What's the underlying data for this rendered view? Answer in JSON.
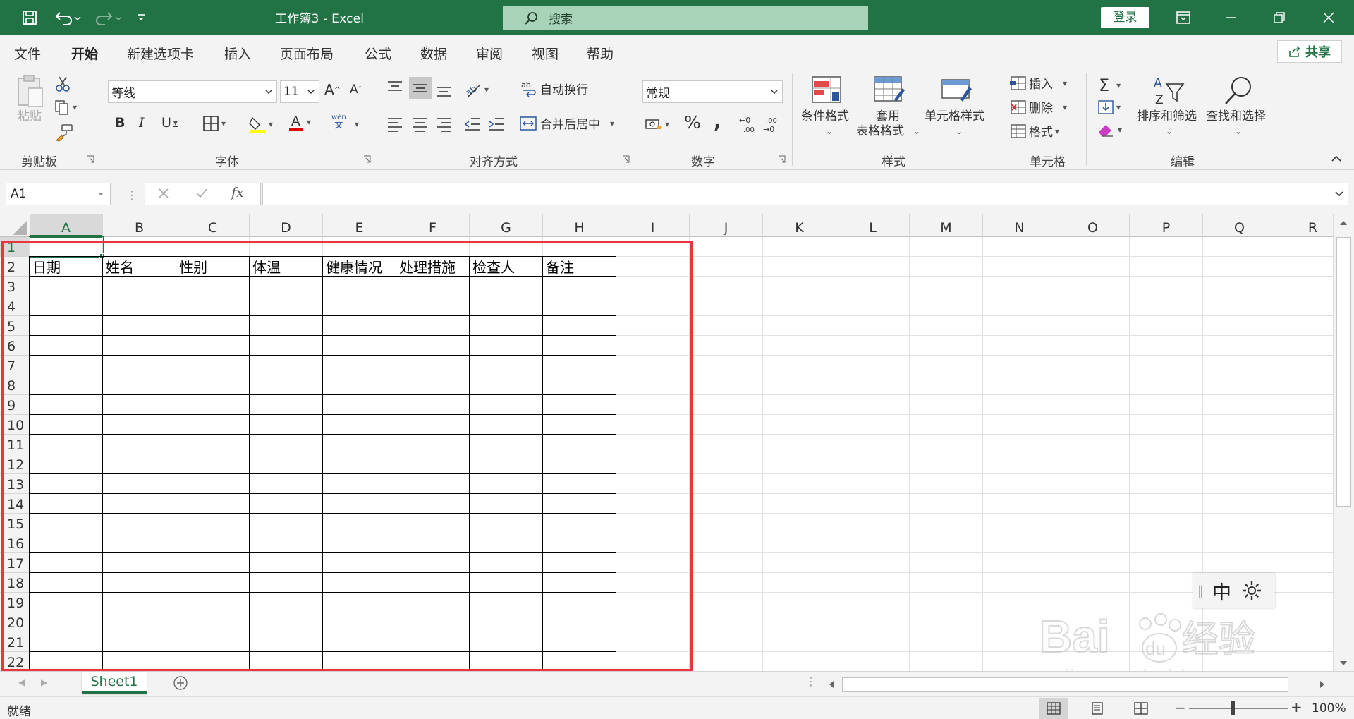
{
  "window": {
    "title": "工作簿3 - Excel",
    "search_placeholder": "搜索",
    "login_label": "登录",
    "accent_color": "#217346"
  },
  "menu": {
    "tabs": [
      {
        "label": "文件",
        "active": false
      },
      {
        "label": "开始",
        "active": true
      },
      {
        "label": "新建选项卡",
        "active": false
      },
      {
        "label": "插入",
        "active": false
      },
      {
        "label": "页面布局",
        "active": false
      },
      {
        "label": "公式",
        "active": false
      },
      {
        "label": "数据",
        "active": false
      },
      {
        "label": "审阅",
        "active": false
      },
      {
        "label": "视图",
        "active": false
      },
      {
        "label": "帮助",
        "active": false
      }
    ],
    "share_label": "共享"
  },
  "ribbon": {
    "clipboard": {
      "label": "剪贴板",
      "paste": "粘贴"
    },
    "font": {
      "label": "字体",
      "font_name": "等线",
      "font_size": "11",
      "bold": "B",
      "italic": "I",
      "underline": "U",
      "phonetic": "wén",
      "phonetic_sub": "文"
    },
    "alignment": {
      "label": "对齐方式",
      "wrap_text": "自动换行",
      "merge_center": "合并后居中"
    },
    "number": {
      "label": "数字",
      "format": "常规",
      "percent": "%",
      "comma": ","
    },
    "styles": {
      "label": "样式",
      "conditional": "条件格式",
      "table_format_1": "套用",
      "table_format_2": "表格格式",
      "cell_styles": "单元格样式"
    },
    "cells": {
      "label": "单元格",
      "insert": "插入",
      "delete": "删除",
      "format": "格式"
    },
    "editing": {
      "label": "编辑",
      "sort_filter": "排序和筛选",
      "find_select": "查找和选择"
    }
  },
  "formula_bar": {
    "name_box": "A1",
    "fx": "fx",
    "value": ""
  },
  "grid": {
    "columns": [
      "A",
      "B",
      "C",
      "D",
      "E",
      "F",
      "G",
      "H",
      "I",
      "J",
      "K",
      "L",
      "M",
      "N",
      "O",
      "P",
      "Q",
      "R"
    ],
    "rows": [
      "1",
      "2",
      "3",
      "4",
      "5",
      "6",
      "7",
      "8",
      "9",
      "10",
      "11",
      "12",
      "13",
      "14",
      "15",
      "16",
      "17",
      "18",
      "19",
      "20",
      "21",
      "22"
    ],
    "selected_cell": "A1",
    "table_headers": [
      "日期",
      "姓名",
      "性别",
      "体温",
      "健康情况",
      "处理措施",
      "检查人",
      "备注"
    ],
    "highlight_color": "#e8363e"
  },
  "ime": {
    "mode": "中"
  },
  "watermark": {
    "brand": "Bai",
    "brand2": "du",
    "product": "经验",
    "url": "jingyan.baidu.com"
  },
  "sheets": [
    {
      "name": "Sheet1",
      "active": true
    }
  ],
  "status": {
    "text": "就绪",
    "zoom": "100%"
  }
}
